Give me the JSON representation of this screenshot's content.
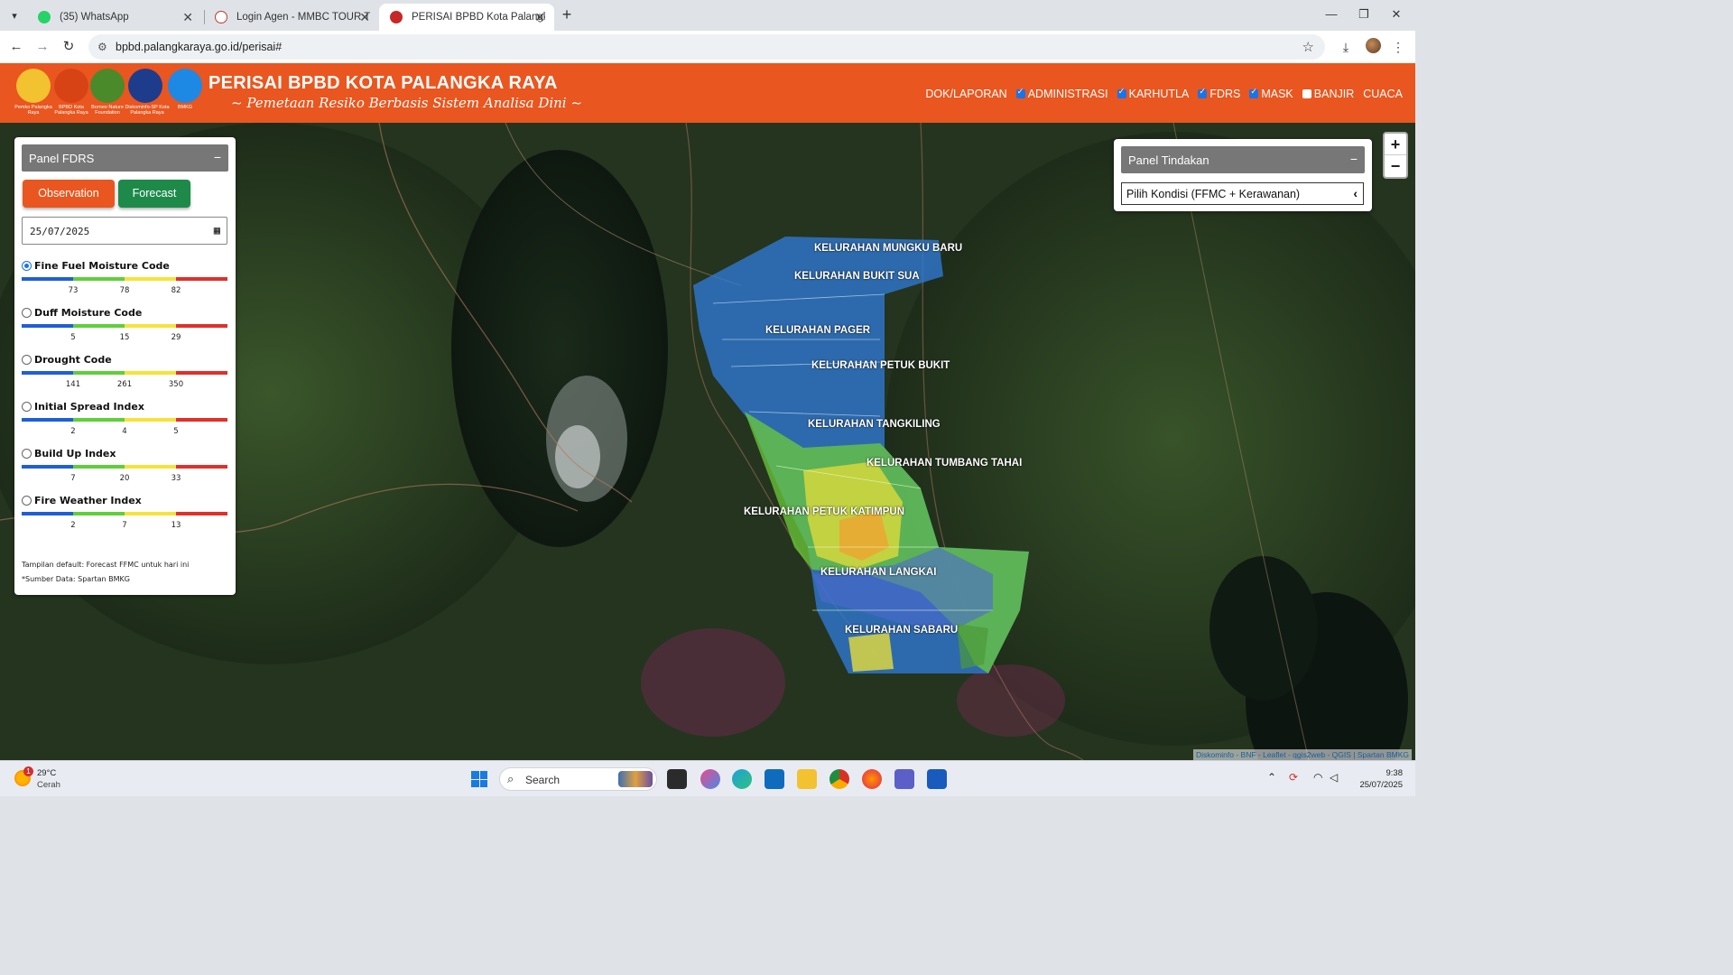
{
  "browser": {
    "tabs": [
      {
        "title": "(35) WhatsApp",
        "badge": "35",
        "color": "#25d366"
      },
      {
        "title": "Login Agen - MMBC TOUR TRA",
        "color": "#c0392b"
      },
      {
        "title": "PERISAI BPBD Kota Palangka Ra",
        "color": "#c62828"
      }
    ],
    "url": "bpbd.palangkaraya.go.id/perisai#"
  },
  "header": {
    "title": "PERISAI BPBD KOTA PALANGKA RAYA",
    "subtitle": "~ Pemetaan Resiko Berbasis Sistem Analisa Dini ~",
    "logos": [
      {
        "caption": "Pemko Palangka Raya",
        "color": "#f2c230"
      },
      {
        "caption": "BPBD Kota Palangka Raya",
        "color": "#d84315"
      },
      {
        "caption": "Borneo Nature Foundation",
        "color": "#4a8a2a"
      },
      {
        "caption": "Diskominfo-SP Kota Palangka Raya",
        "color": "#1e3c8c"
      },
      {
        "caption": "BMKG",
        "color": "#1e88e5"
      }
    ],
    "nav": [
      {
        "label": "DOK/LAPORAN",
        "checkbox": false
      },
      {
        "label": "ADMINISTRASI",
        "checkbox": true,
        "checked": true
      },
      {
        "label": "KARHUTLA",
        "checkbox": true,
        "checked": true
      },
      {
        "label": "FDRS",
        "checkbox": true,
        "checked": true
      },
      {
        "label": "MASK",
        "checkbox": true,
        "checked": true
      },
      {
        "label": "BANJIR",
        "checkbox": true,
        "checked": false
      },
      {
        "label": "CUACA",
        "checkbox": false
      }
    ]
  },
  "panel_fdrs": {
    "title": "Panel FDRS",
    "collapse": "−",
    "observation_label": "Observation",
    "forecast_label": "Forecast",
    "date_value": "25/07/2025",
    "scale_colors": [
      "#1f5fd6",
      "#5fcf3a",
      "#f5e33a",
      "#e0302a"
    ],
    "indices": [
      {
        "name": "Fine Fuel Moisture Code",
        "selected": true,
        "ticks": [
          "73",
          "78",
          "82"
        ]
      },
      {
        "name": "Duff Moisture Code",
        "selected": false,
        "ticks": [
          "5",
          "15",
          "29"
        ]
      },
      {
        "name": "Drought Code",
        "selected": false,
        "ticks": [
          "141",
          "261",
          "350"
        ]
      },
      {
        "name": "Initial Spread Index",
        "selected": false,
        "ticks": [
          "2",
          "4",
          "5"
        ]
      },
      {
        "name": "Build Up Index",
        "selected": false,
        "ticks": [
          "7",
          "20",
          "33"
        ]
      },
      {
        "name": "Fire Weather Index",
        "selected": false,
        "ticks": [
          "2",
          "7",
          "13"
        ]
      }
    ],
    "note1": "Tampilan default: Forecast FFMC untuk hari ini",
    "note2": "*Sumber Data: Spartan BMKG"
  },
  "panel_tindakan": {
    "title": "Panel Tindakan",
    "collapse": "−",
    "select_value": "Pilih Kondisi (FFMC + Kerawanan)"
  },
  "map": {
    "zoom_in": "+",
    "zoom_out": "−",
    "attribution": "Diskominfo - BNF - Leaflet - qgis2web - QGIS | Spartan BMKG",
    "kelurahan": [
      "KELURAHAN MUNGKU BARU",
      "KELURAHAN BUKIT SUA",
      "KELURAHAN PAGER",
      "KELURAHAN PETUK BUKIT",
      "KELURAHAN TANGKILING",
      "KELURAHAN TUMBANG TAHAI",
      "KELURAHAN PETUK KATIMPUN",
      "KELURAHAN LANGKAI",
      "KELURAHAN SABARU"
    ]
  },
  "taskbar": {
    "temp": "29°C",
    "weather": "Cerah",
    "weather_badge": "1",
    "search": "Search",
    "time": "9:38",
    "date": "25/07/2025"
  }
}
